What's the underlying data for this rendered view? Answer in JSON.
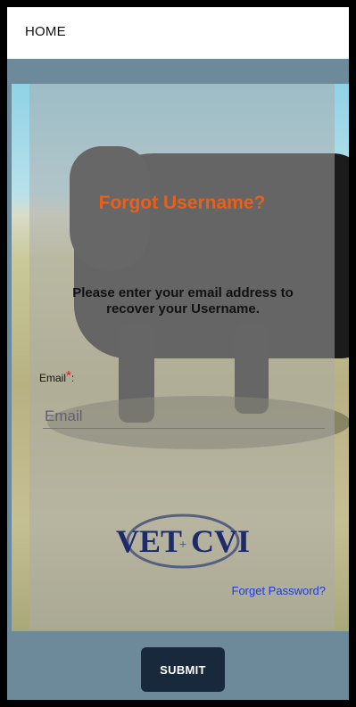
{
  "header": {
    "title": "HOME"
  },
  "form": {
    "heading": "Forgot Username?",
    "description": "Please enter your email address to recover your Username.",
    "email_label": "Email",
    "email_required_mark": "*",
    "email_label_suffix": ":",
    "email_placeholder": "Email",
    "email_value": ""
  },
  "logo": {
    "text_left": "VET",
    "text_right": "CVI"
  },
  "links": {
    "forget_password": "Forget Password?"
  },
  "actions": {
    "submit_label": "SUBMIT"
  },
  "colors": {
    "heading": "#e8601c",
    "link": "#1f3be0",
    "submit_bg": "#18293b",
    "frame_bg": "#6c8a9a"
  }
}
